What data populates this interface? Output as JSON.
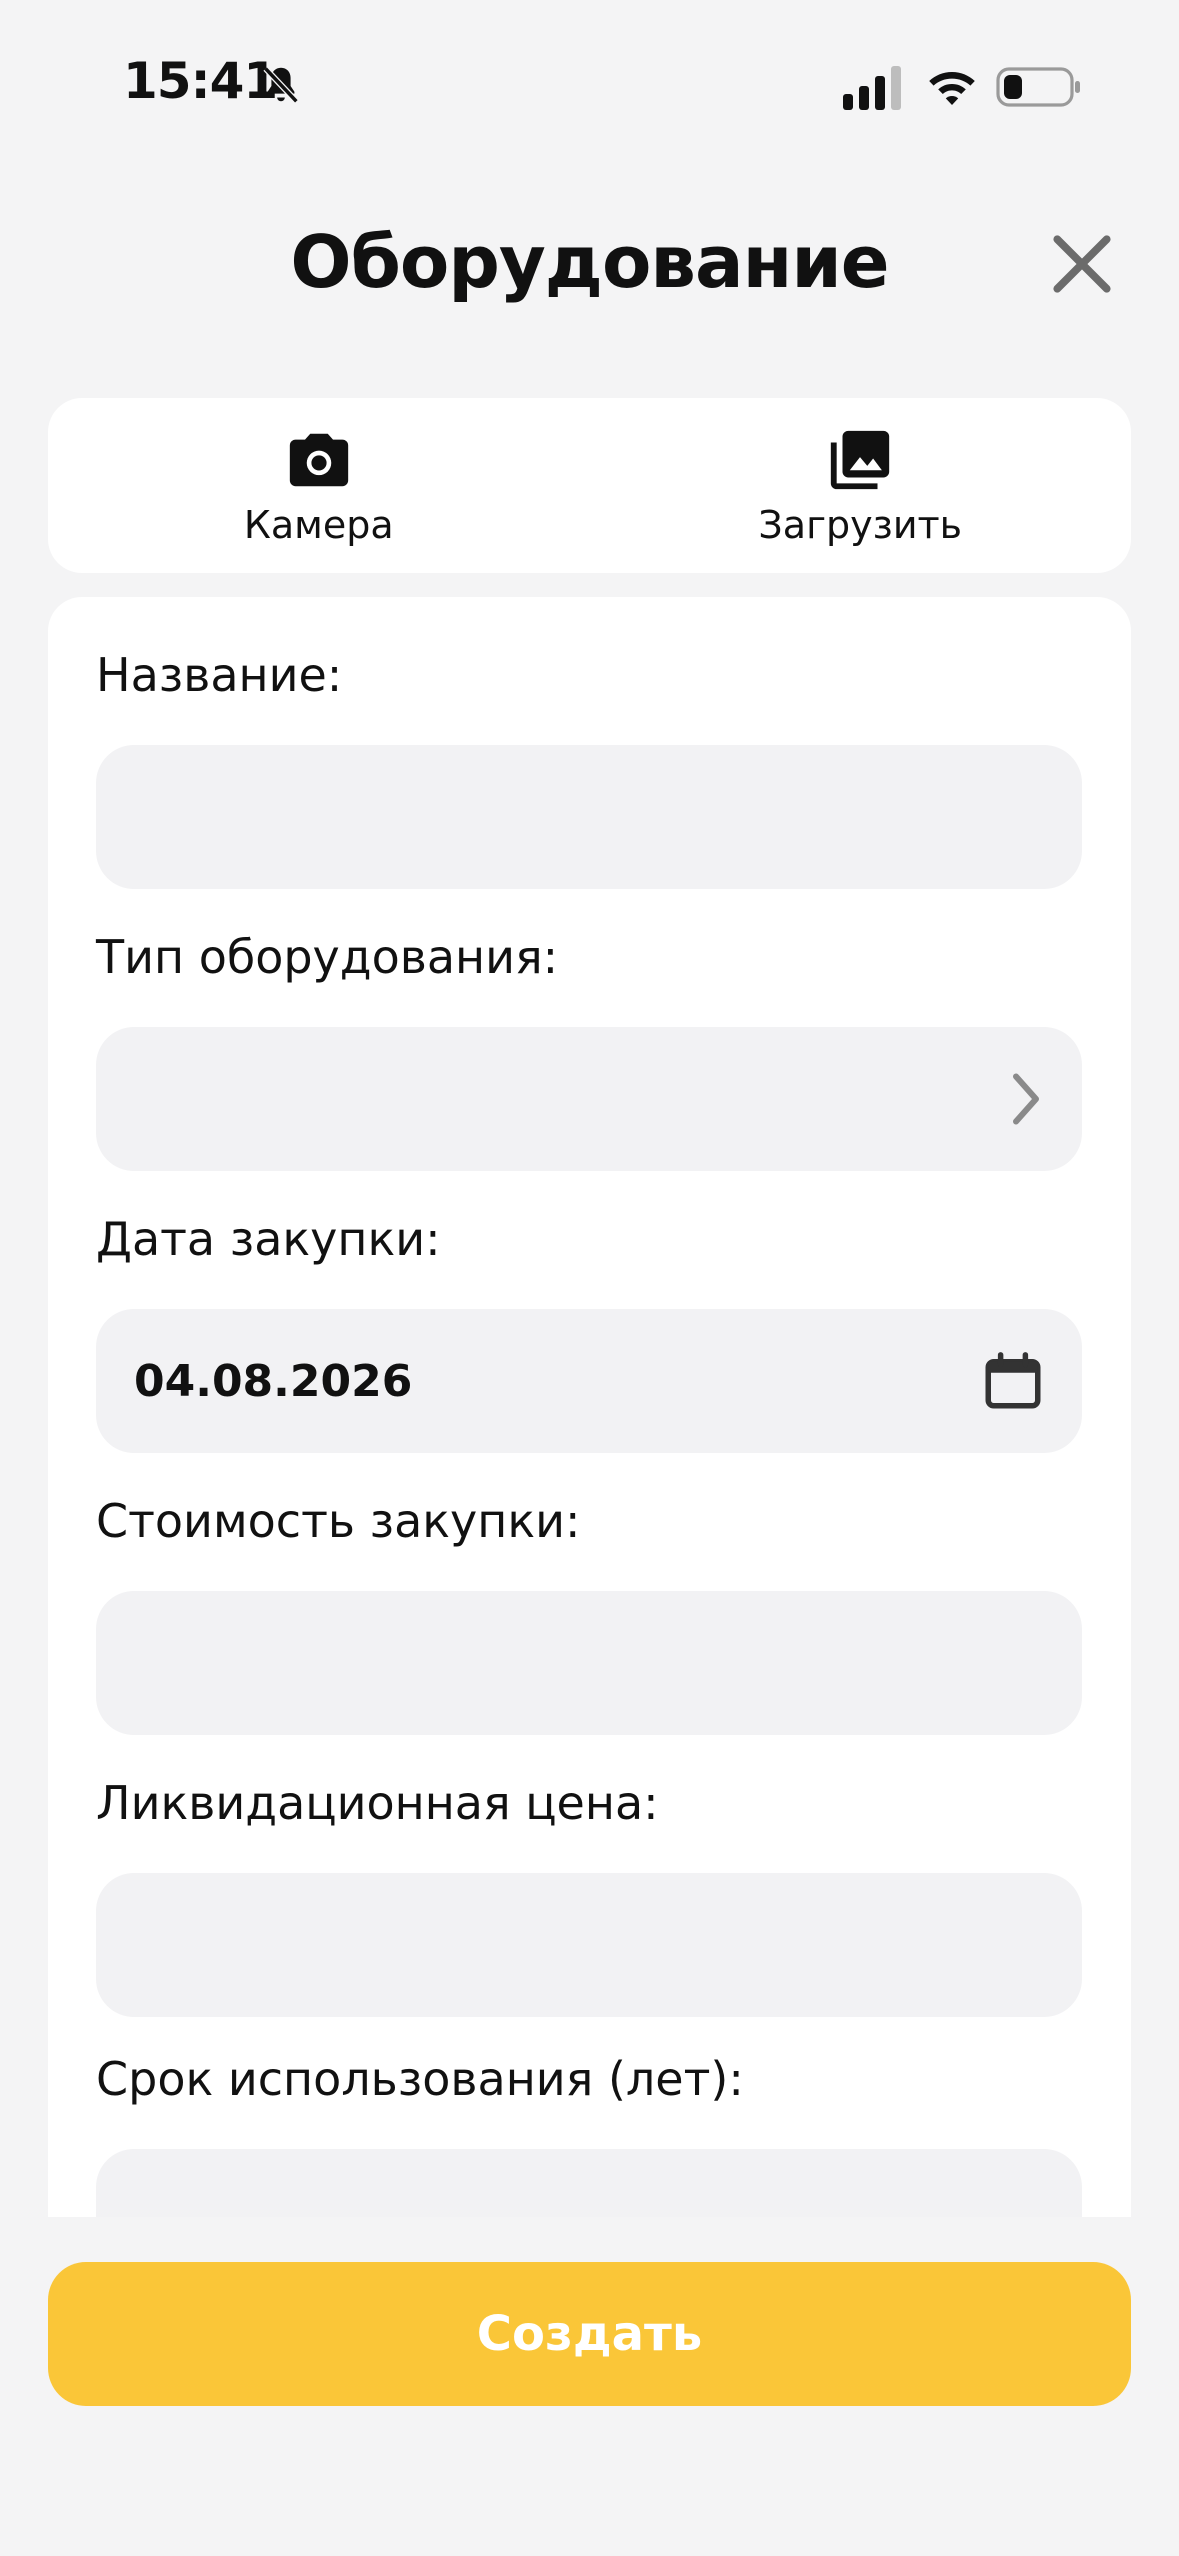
{
  "status_bar": {
    "time": "15:41"
  },
  "header": {
    "title": "Оборудование"
  },
  "media": {
    "camera_label": "Камера",
    "upload_label": "Загрузить"
  },
  "form": {
    "name": {
      "label": "Название:",
      "value": ""
    },
    "equipment_type": {
      "label": "Тип оборудования:",
      "value": ""
    },
    "purchase_date": {
      "label": "Дата закупки:",
      "value": "04.08.2026"
    },
    "purchase_cost": {
      "label": "Стоимость закупки:",
      "value": ""
    },
    "liquidation_price": {
      "label": "Ликвидационная цена:",
      "value": ""
    },
    "usage_term": {
      "label": "Срок использования (лет):",
      "value": ""
    }
  },
  "actions": {
    "create_label": "Создать"
  },
  "colors": {
    "accent": "#fac638",
    "background": "#f4f4f5",
    "input_bg": "#f2f2f4"
  }
}
